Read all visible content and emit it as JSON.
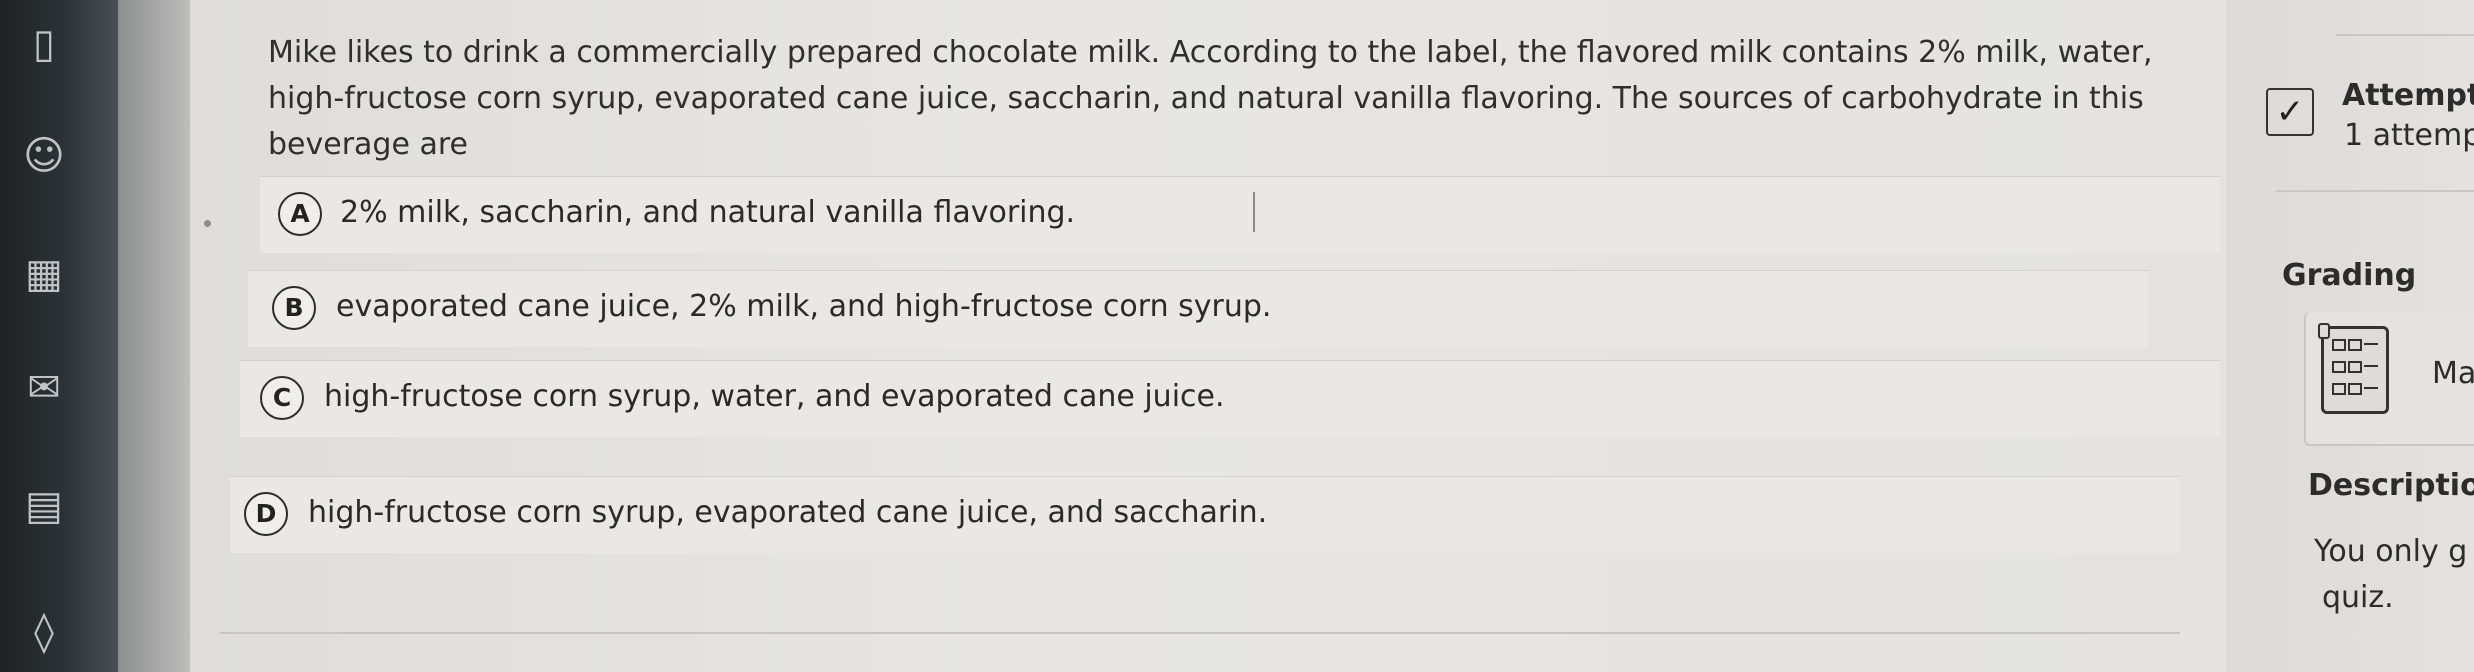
{
  "sidebar": {
    "icons": [
      "document-icon",
      "people-icon",
      "calendar-icon",
      "inbox-icon",
      "news-icon",
      "tag-icon"
    ]
  },
  "question": {
    "prompt": "Mike likes to drink a commercially prepared chocolate milk. According to the label, the flavored milk contains 2% milk, water, high-fructose corn syrup, evaporated cane juice, saccharin, and natural vanilla flavoring. The sources of carbohydrate in this beverage are",
    "choices": [
      {
        "letter": "A",
        "text": "2% milk, saccharin, and natural vanilla flavoring."
      },
      {
        "letter": "B",
        "text": "evaporated cane juice, 2% milk, and high-fructose corn syrup."
      },
      {
        "letter": "C",
        "text": "high-fructose corn syrup, water, and evaporated cane juice."
      },
      {
        "letter": "D",
        "text": "high-fructose corn syrup, evaporated cane juice, and saccharin."
      }
    ]
  },
  "right_panel": {
    "attempts_label": "Attempt",
    "attempts_value": "1 attemp",
    "grading_label": "Grading",
    "grading_value": "Ma",
    "description_label": "Descriptio",
    "description_line1": "You only g",
    "description_line2": "quiz."
  }
}
